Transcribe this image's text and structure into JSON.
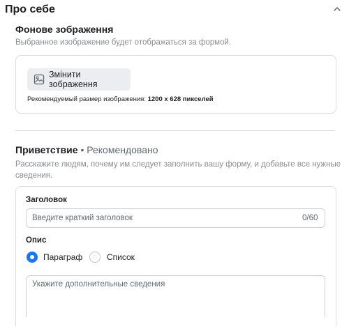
{
  "section": {
    "title": "Про себе"
  },
  "background": {
    "title": "Фонове зображення",
    "subtitle": "Выбранное изображение будет отображаться за формой.",
    "change_button": "Змінити зображення",
    "recommended_label": "Рекомендуемый размер изображения:",
    "recommended_size": "1200 x 628 пикселей"
  },
  "greeting": {
    "title": "Приветствие",
    "separator": " • ",
    "badge": "Рекомендовано",
    "description_line1": "Расскажите людям, почему им следует заполнить вашу форму, и добавьте все нужные",
    "description_line2": "сведения.",
    "header_label": "Заголовок",
    "header_placeholder": "Введите краткий заголовок",
    "header_counter": "0/60",
    "description_label": "Опис",
    "radio_paragraph": "Параграф",
    "radio_list": "Список",
    "details_placeholder": "Укажите дополнительные сведения"
  },
  "icons": {
    "collapse": "chevron-up-icon",
    "image": "image-icon"
  },
  "colors": {
    "accent": "#1877f2",
    "muted_text": "#8a8d91",
    "button_bg": "#ebedf0",
    "border": "#dadde1"
  }
}
